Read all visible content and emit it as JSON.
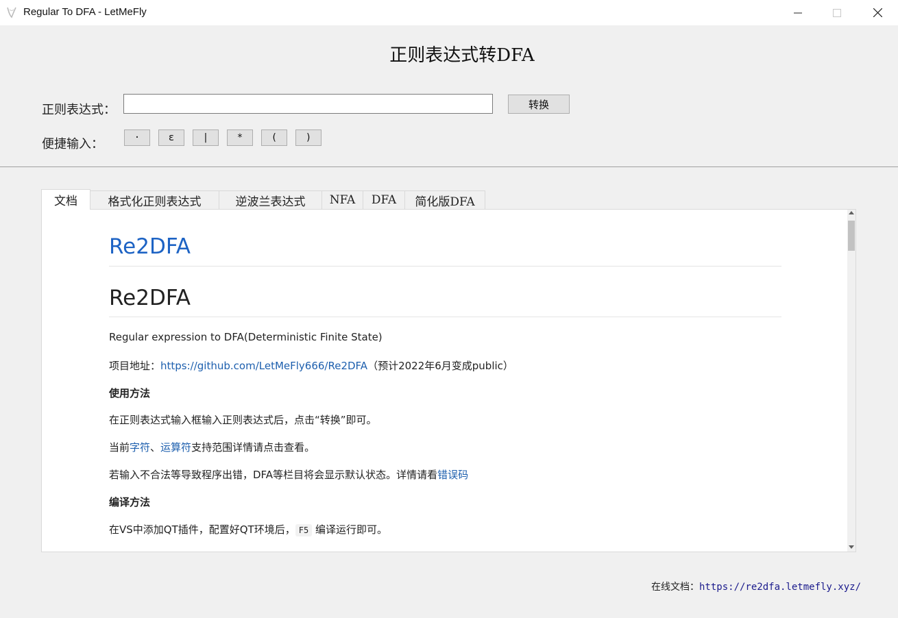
{
  "window": {
    "title": "Regular To DFA - LetMeFly",
    "icon": "letmefly-logo-icon",
    "controls": {
      "minimize": "—",
      "maximize": "☐",
      "close": "✕"
    }
  },
  "header": {
    "title": "正则表达式转DFA",
    "regex_label": "正则表达式：",
    "regex_input_value": "",
    "convert_label": "转换",
    "quick_label": "便捷输入：",
    "quick_buttons": [
      "·",
      "ε",
      "|",
      "*",
      "(",
      ")"
    ]
  },
  "tabs": [
    {
      "label": "文档",
      "active": true
    },
    {
      "label": "格式化正则表达式",
      "active": false
    },
    {
      "label": "逆波兰表达式",
      "active": false
    },
    {
      "label": "NFA",
      "active": false
    },
    {
      "label": "DFA",
      "active": false
    },
    {
      "label": "简化版DFA",
      "active": false
    }
  ],
  "doc": {
    "h1_link": "Re2DFA",
    "h1": "Re2DFA",
    "intro": "Regular expression to DFA(Deterministic Finite State)",
    "project_prefix": "项目地址：",
    "project_link": "https://github.com/LetMeFly666/Re2DFA",
    "project_suffix": "（预计2022年6月变成public）",
    "usage_heading": "使用方法",
    "usage_text": "在正则表达式输入框输入正则表达式后，点击“转换”即可。",
    "support_prefix": "当前",
    "support_link1": "字符",
    "support_sep": "、",
    "support_link2": "运算符",
    "support_suffix": "支持范围详情请点击查看。",
    "error_text": "若输入不合法等导致程序出错，DFA等栏目将会显示默认状态。详情请看",
    "error_link": "错误码",
    "compile_heading": "编译方法",
    "compile_prefix": "在VS中添加QT插件，配置好QT环境后，",
    "compile_key": "F5",
    "compile_suffix": " 编译运行即可。"
  },
  "footer": {
    "label": "在线文档：",
    "link": "https://re2dfa.letmefly.xyz/"
  }
}
